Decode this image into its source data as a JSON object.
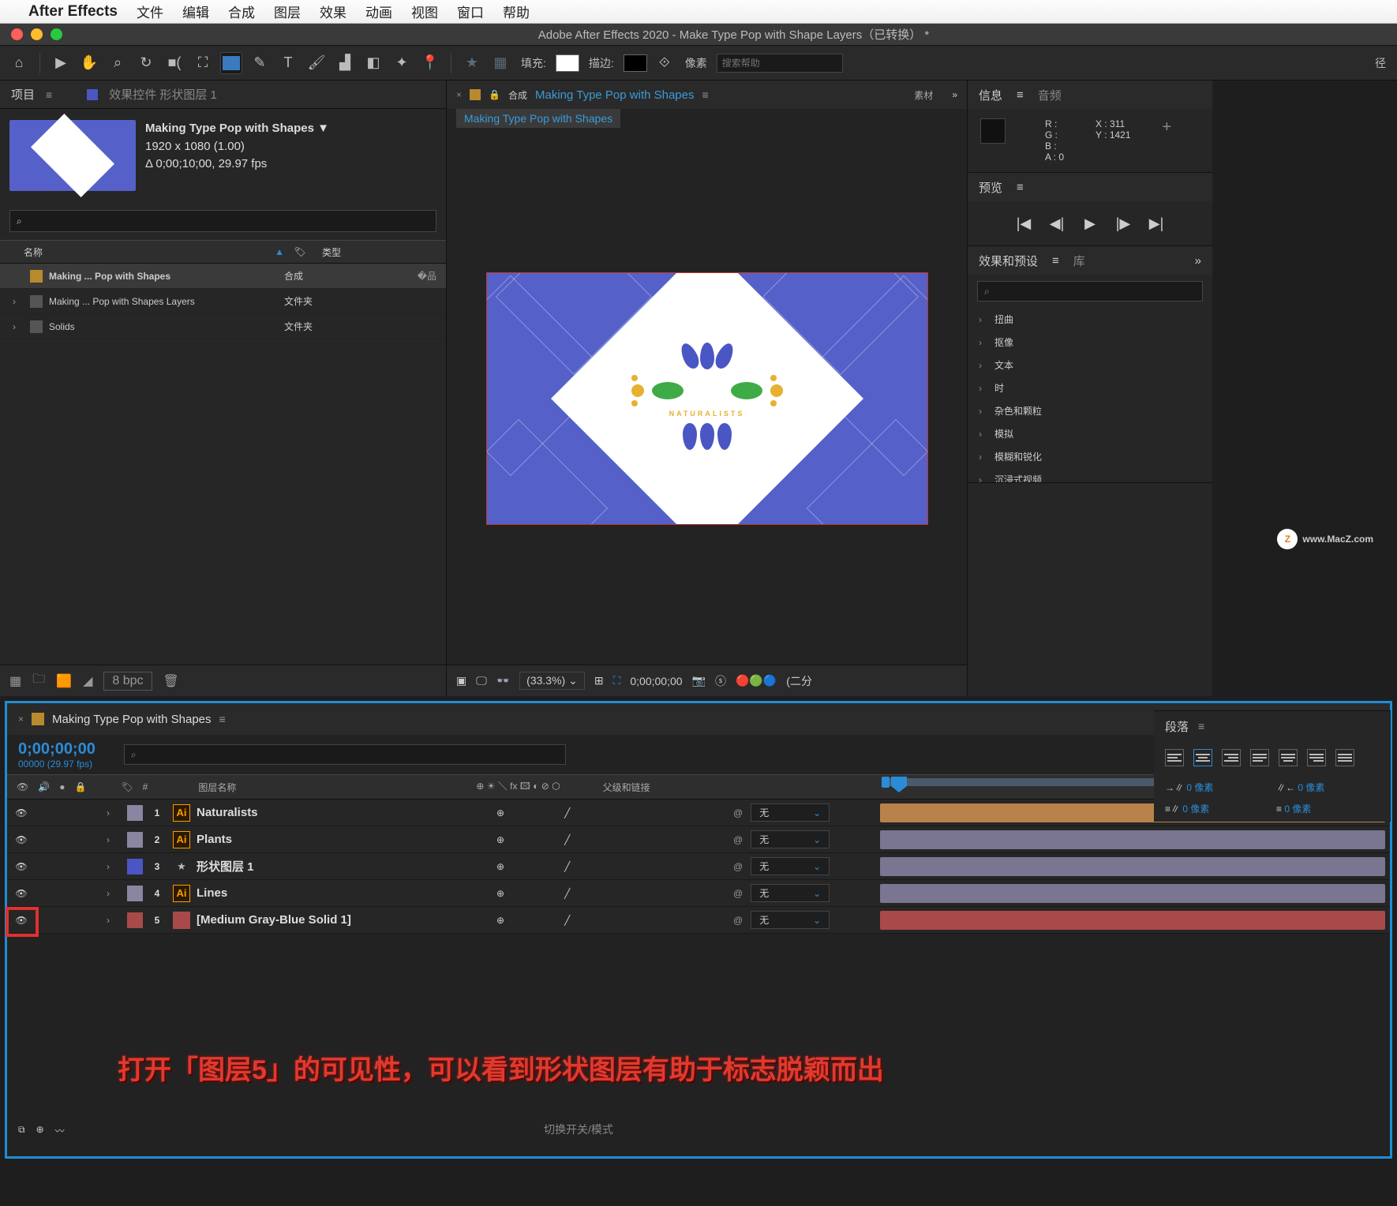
{
  "menubar": {
    "app": "After Effects",
    "items": [
      "文件",
      "编辑",
      "合成",
      "图层",
      "效果",
      "动画",
      "视图",
      "窗口",
      "帮助"
    ]
  },
  "window_title": "Adobe After Effects 2020 - Make Type Pop with Shape Layers（已转换） *",
  "toolbar": {
    "fill": "填充:",
    "stroke": "描边:",
    "px_label": "像素",
    "search_placeholder": "搜索帮助",
    "radius": "径"
  },
  "project": {
    "tab": "项目",
    "fx_tab": "效果控件 形状图层 1",
    "title": "Making Type Pop with Shapes ▼",
    "dims": "1920 x 1080 (1.00)",
    "dur": "Δ 0;00;10;00, 29.97 fps",
    "search": "⌕",
    "cols": {
      "name": "名称",
      "type": "类型"
    },
    "rows": [
      {
        "name": "Making ... Pop with Shapes",
        "type": "合成",
        "sel": true,
        "comp": true
      },
      {
        "name": "Making ... Pop with Shapes Layers",
        "type": "文件夹"
      },
      {
        "name": "Solids",
        "type": "文件夹"
      }
    ],
    "bpc": "8 bpc"
  },
  "comp": {
    "tab_label": "合成",
    "tab_name": "Making Type Pop with Shapes",
    "sidebar": "素材",
    "breadcrumb": "Making Type Pop with Shapes",
    "brand": "NATURALISTS",
    "zoom": "(33.3%)",
    "tc": "0;00;00;00",
    "half": "(二分"
  },
  "info": {
    "label": "信息",
    "audio": "音频",
    "R": "R :",
    "G": "G :",
    "B": "B :",
    "A": "A :  0",
    "X": "X : 311",
    "Y": "Y : 1421"
  },
  "preview": {
    "label": "预览"
  },
  "fx": {
    "label": "效果和预设",
    "lib": "库",
    "items": [
      "扭曲",
      "抠像",
      "文本",
      "时",
      "杂色和颗粒",
      "模拟",
      "模糊和锐化",
      "沉浸式视频"
    ]
  },
  "timeline": {
    "title": "Making Type Pop with Shapes",
    "tc": "0;00;00;00",
    "fps": "00000 (29.97 fps)",
    "cols": {
      "num": "#",
      "name": "图层名称",
      "parent": "父级和链接"
    },
    "none": "无",
    "switch_mode": "切换开关/模式",
    "layers": [
      {
        "n": "1",
        "name": "Naturalists",
        "sw": "#8a85a0",
        "ico": "ai",
        "bar": "b-orange"
      },
      {
        "n": "2",
        "name": "Plants",
        "sw": "#8a85a0",
        "ico": "ai",
        "bar": "b-purple"
      },
      {
        "n": "3",
        "name": "形状图层 1",
        "sw": "#4a56c4",
        "ico": "shape",
        "bar": "b-purple"
      },
      {
        "n": "4",
        "name": "Lines",
        "sw": "#8a85a0",
        "ico": "ai",
        "bar": "b-purple"
      },
      {
        "n": "5",
        "name": "[Medium Gray-Blue Solid 1]",
        "sw": "#a84a4a",
        "ico": "solid",
        "bar": "b-red"
      }
    ]
  },
  "paragraph": {
    "label": "段落",
    "px": "像素",
    "vals": [
      "0",
      "0",
      "0",
      "0"
    ]
  },
  "caption": "打开「图层5」的可见性，可以看到形状图层有助于标志脱颖而出",
  "watermark": "www.MacZ.com"
}
